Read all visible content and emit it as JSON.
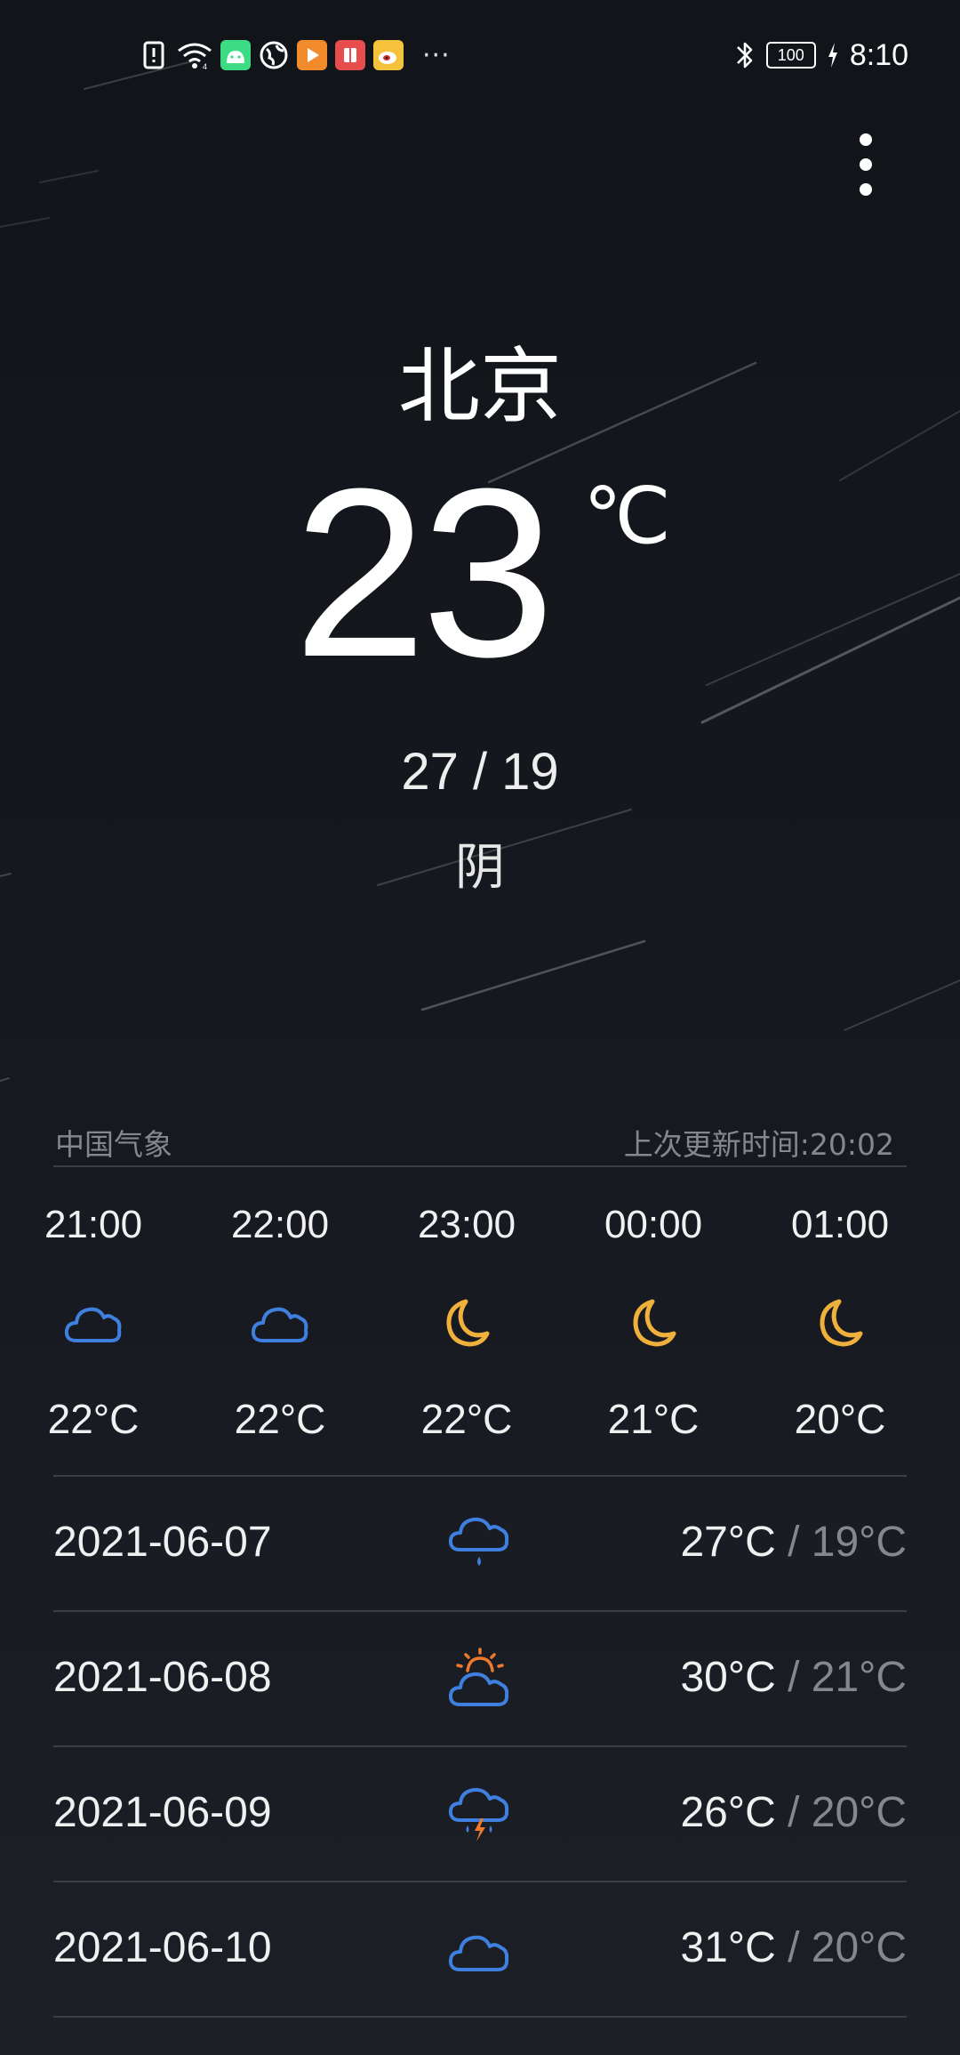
{
  "status_bar": {
    "left_icons": [
      "sim-alert-icon",
      "wifi-icon",
      "android-icon",
      "globe-icon",
      "video-app-icon",
      "book-app-icon",
      "weibo-icon"
    ],
    "more_text": "···",
    "battery_text": "100",
    "time": "8:10"
  },
  "menu": {
    "icon": "more-vert-icon"
  },
  "current": {
    "city": "北京",
    "temperature": "23",
    "unit": "℃",
    "range": "27 / 19",
    "condition": "阴"
  },
  "info": {
    "source": "中国气象",
    "updated": "上次更新时间:20:02"
  },
  "hourly": [
    {
      "time": "21:00",
      "icon": "cloudy-icon",
      "temp": "22°C"
    },
    {
      "time": "22:00",
      "icon": "cloudy-icon",
      "temp": "22°C"
    },
    {
      "time": "23:00",
      "icon": "moon-icon",
      "temp": "22°C"
    },
    {
      "time": "00:00",
      "icon": "moon-icon",
      "temp": "21°C"
    },
    {
      "time": "01:00",
      "icon": "moon-icon",
      "temp": "20°C"
    }
  ],
  "daily": [
    {
      "date": "2021-06-07",
      "icon": "rain-icon",
      "high": "27°C",
      "sep": " / ",
      "low": "19°C"
    },
    {
      "date": "2021-06-08",
      "icon": "partly-sunny-icon",
      "high": "30°C",
      "sep": " / ",
      "low": "21°C"
    },
    {
      "date": "2021-06-09",
      "icon": "thunder-rain-icon",
      "high": "26°C",
      "sep": " / ",
      "low": "20°C"
    },
    {
      "date": "2021-06-10",
      "icon": "cloudy-icon",
      "high": "31°C",
      "sep": " / ",
      "low": "20°C"
    }
  ],
  "colors": {
    "background": "#14171c",
    "cloud": "#3f7fe0",
    "moon": "#f0b03c",
    "sun": "#f07a2c",
    "secondary_text": "#85878c",
    "divider": "#3b3e45"
  }
}
